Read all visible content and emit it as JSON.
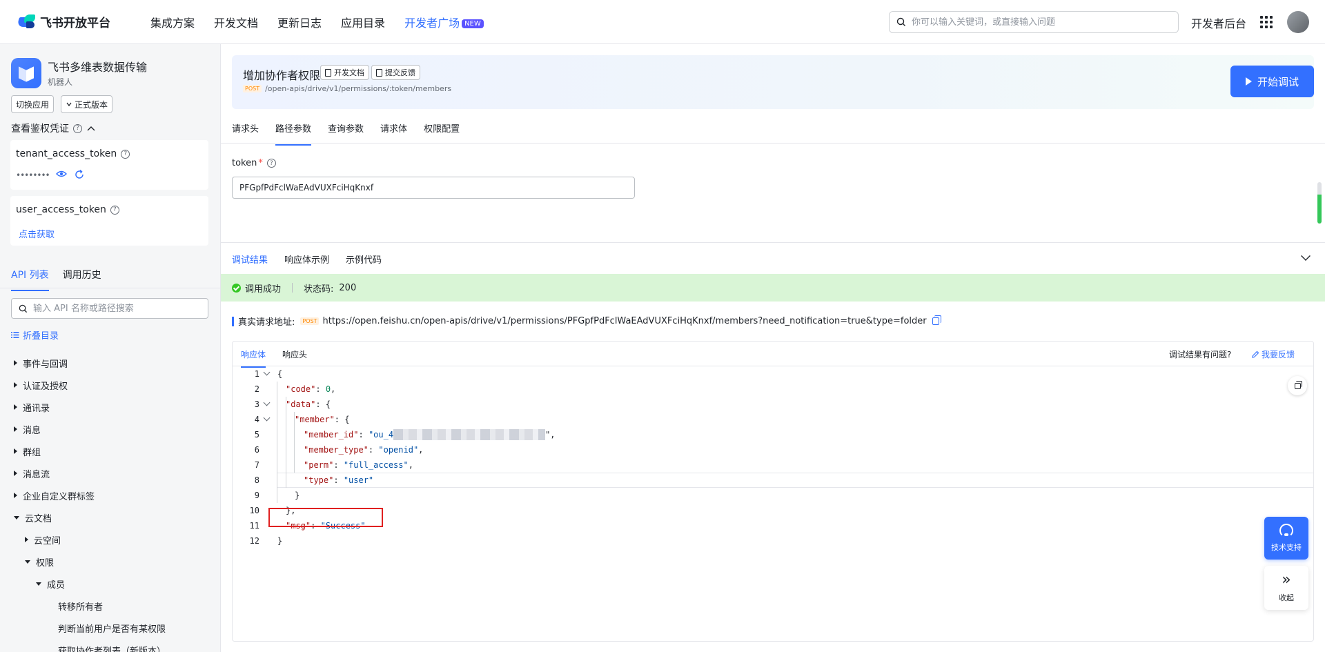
{
  "topnav": {
    "logo_text": "飞书开放平台",
    "items": [
      {
        "label": "集成方案"
      },
      {
        "label": "开发文档"
      },
      {
        "label": "更新日志"
      },
      {
        "label": "应用目录"
      },
      {
        "label": "开发者广场",
        "badge": "NEW",
        "active": true
      }
    ],
    "search_placeholder": "你可以输入关键词，或直接输入问题",
    "dev_console": "开发者后台"
  },
  "sidebar": {
    "app_name": "飞书多维表数据传输",
    "app_type": "机器人",
    "switch_app": "切换应用",
    "version": "正式版本",
    "auth_title": "查看鉴权凭证",
    "tenant_token": {
      "label": "tenant_access_token",
      "mask": "••••••••"
    },
    "user_token": {
      "label": "user_access_token",
      "action": "点击获取"
    },
    "tabs": [
      {
        "label": "API 列表",
        "active": true
      },
      {
        "label": "调用历史"
      }
    ],
    "search_placeholder": "输入 API 名称或路径搜索",
    "collapse_dir": "折叠目录",
    "tree": [
      {
        "label": "事件与回调",
        "expanded": false,
        "level": 0
      },
      {
        "label": "认证及授权",
        "expanded": false,
        "level": 0
      },
      {
        "label": "通讯录",
        "expanded": false,
        "level": 0
      },
      {
        "label": "消息",
        "expanded": false,
        "level": 0
      },
      {
        "label": "群组",
        "expanded": false,
        "level": 0
      },
      {
        "label": "消息流",
        "expanded": false,
        "level": 0
      },
      {
        "label": "企业自定义群标签",
        "expanded": false,
        "level": 0
      },
      {
        "label": "云文档",
        "expanded": true,
        "level": 0
      },
      {
        "label": "云空间",
        "expanded": false,
        "level": 1
      },
      {
        "label": "权限",
        "expanded": true,
        "level": 1
      },
      {
        "label": "成员",
        "expanded": true,
        "level": 2
      },
      {
        "label": "转移所有者",
        "leaf": true,
        "level": 3
      },
      {
        "label": "判断当前用户是否有某权限",
        "leaf": true,
        "level": 3
      },
      {
        "label": "获取协作者列表（新版本）",
        "leaf": true,
        "level": 3
      }
    ]
  },
  "api": {
    "title": "增加协作者权限",
    "doc_chip": "开发文档",
    "feedback_chip": "提交反馈",
    "method": "POST",
    "path": "/open-apis/drive/v1/permissions/:token/members",
    "start_button": "开始调试",
    "req_tabs": [
      {
        "label": "请求头"
      },
      {
        "label": "路径参数",
        "active": true
      },
      {
        "label": "查询参数"
      },
      {
        "label": "请求体"
      },
      {
        "label": "权限配置"
      }
    ],
    "token_label": "token",
    "token_value": "PFGpfPdFclWaEAdVUXFciHqKnxf"
  },
  "result": {
    "tabs": [
      {
        "label": "调试结果",
        "active": true
      },
      {
        "label": "响应体示例"
      },
      {
        "label": "示例代码"
      }
    ],
    "status_text": "调用成功",
    "status_code_label": "状态码:",
    "status_code": "200",
    "url_label": "真实请求地址:",
    "url_method": "POST",
    "url": "https://open.feishu.cn/open-apis/drive/v1/permissions/PFGpfPdFclWaEAdVUXFciHqKnxf/members?need_notification=true&type=folder",
    "body_tabs": [
      {
        "label": "响应体",
        "active": true
      },
      {
        "label": "响应头"
      }
    ],
    "issue_question": "调试结果有问题?",
    "feedback_link": "我要反馈",
    "code_lines": [
      {
        "n": "1",
        "text": "{"
      },
      {
        "n": "2",
        "text": "\"code\": 0,"
      },
      {
        "n": "3",
        "text": "\"data\": {"
      },
      {
        "n": "4",
        "text": "\"member\": {"
      },
      {
        "n": "5",
        "text": "\"member_id\": \"ou_4"
      },
      {
        "n": "6",
        "text": "\"member_type\": \"openid\","
      },
      {
        "n": "7",
        "text": "\"perm\": \"full_access\","
      },
      {
        "n": "8",
        "text": "\"type\": \"user\""
      },
      {
        "n": "9",
        "text": "}"
      },
      {
        "n": "10",
        "text": "},"
      },
      {
        "n": "11",
        "text": "\"msg\": \"Success\""
      },
      {
        "n": "12",
        "text": "}"
      }
    ]
  },
  "floating": {
    "tech_support": "技术支持",
    "collapse": "收起"
  },
  "colors": {
    "accent": "#3370ff",
    "success_bg": "#d9f5d6",
    "highlight_box": "#e02020"
  }
}
